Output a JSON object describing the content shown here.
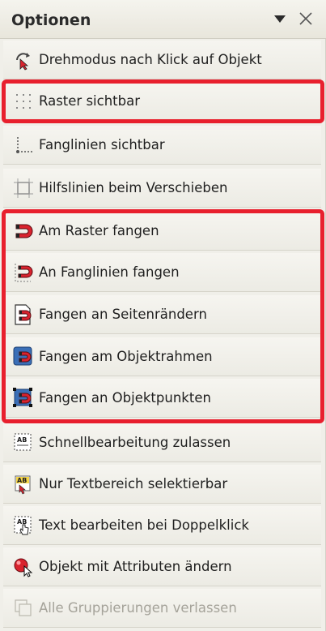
{
  "panel": {
    "title": "Optionen",
    "dropdown_icon": "triangle-down-icon",
    "close_icon": "close-icon"
  },
  "options": [
    {
      "label": "Drehmodus nach Klick auf Objekt",
      "icon": "rotate-mode-icon"
    },
    {
      "label": "Raster sichtbar",
      "icon": "grid-icon"
    },
    {
      "label": "Fanglinien sichtbar",
      "icon": "snap-lines-icon"
    },
    {
      "label": "Hilfslinien beim Verschieben",
      "icon": "guidelines-icon"
    },
    {
      "label": "Am Raster fangen",
      "icon": "magnet-grid-icon"
    },
    {
      "label": "An Fanglinien fangen",
      "icon": "magnet-snaplines-icon"
    },
    {
      "label": "Fangen an Seitenrändern",
      "icon": "magnet-page-margins-icon"
    },
    {
      "label": "Fangen am Objektrahmen",
      "icon": "magnet-object-frame-icon"
    },
    {
      "label": "Fangen an Objektpunkten",
      "icon": "magnet-object-points-icon"
    },
    {
      "label": "Schnellbearbeitung zulassen",
      "icon": "quick-edit-icon"
    },
    {
      "label": "Nur Textbereich selektierbar",
      "icon": "text-area-select-icon"
    },
    {
      "label": "Text bearbeiten bei Doppelklick",
      "icon": "text-edit-doubleclick-icon"
    },
    {
      "label": "Objekt mit Attributen ändern",
      "icon": "object-attributes-icon"
    },
    {
      "label": "Alle Gruppierungen verlassen",
      "icon": "exit-groups-icon",
      "disabled": true
    }
  ],
  "colors": {
    "highlight": "#e8202e",
    "magnet_red": "#d9232e",
    "magnet_blue": "#3a6fb7"
  }
}
